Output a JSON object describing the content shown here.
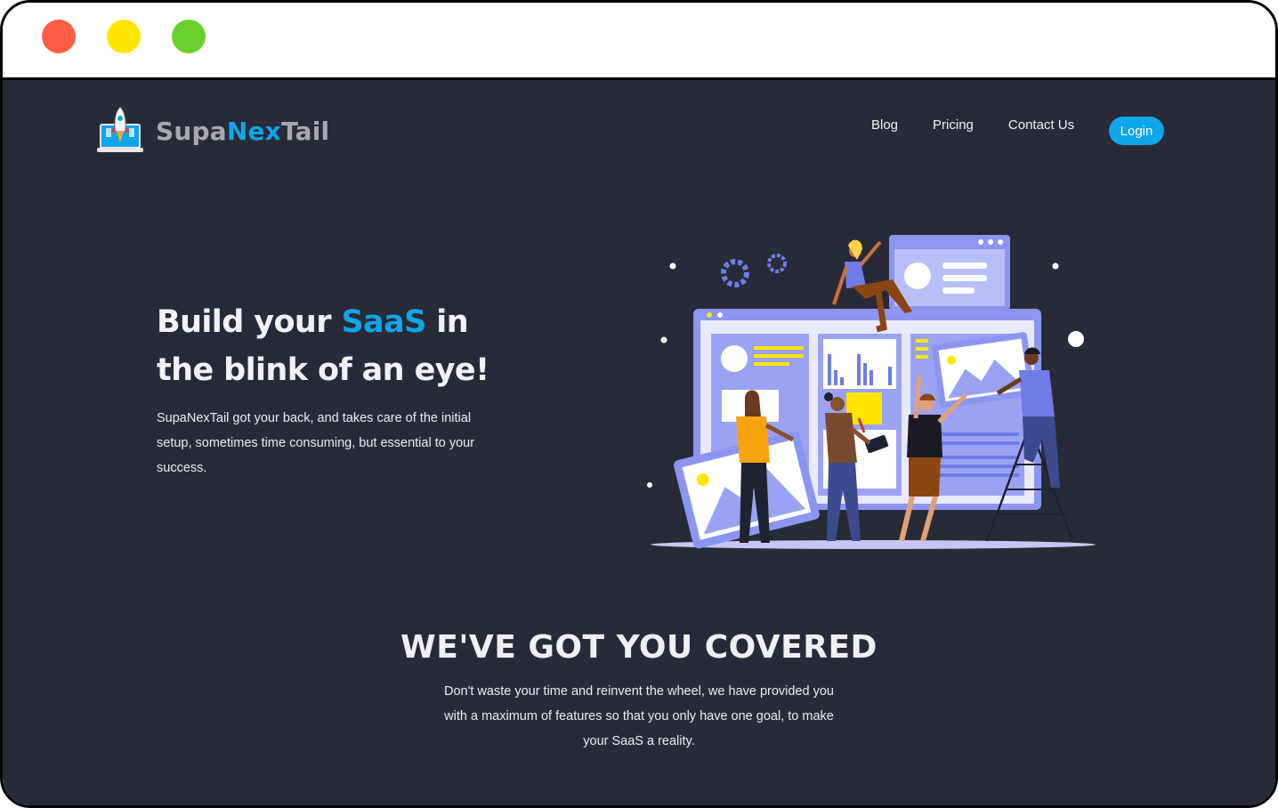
{
  "window": {
    "controls": [
      "close",
      "minimize",
      "maximize"
    ]
  },
  "brand": {
    "name_part1": "Supa",
    "name_part2": "Nex",
    "name_part3": "Tail",
    "logo_icon": "rocket-laptop-icon",
    "accent_color": "#0ea5e9"
  },
  "nav": {
    "links": [
      "Blog",
      "Pricing",
      "Contact Us"
    ],
    "login_label": "Login"
  },
  "hero": {
    "title_pre": "Build your ",
    "title_accent": "SaaS",
    "title_post": " in the blink of an eye!",
    "description": "SupaNexTail got your back, and takes care of the initial setup, sometimes time consuming, but essential to your success.",
    "illustration": "team-building-dashboard-illustration"
  },
  "features": {
    "title": "WE'VE GOT YOU COVERED",
    "description": "Don't waste your time and reinvent the wheel, we have provided you with a maximum of features so that you only have one goal, to make your SaaS a reality."
  },
  "colors": {
    "background": "#282b37",
    "accent": "#0ea5e9",
    "illustration_primary": "#8c96f0",
    "illustration_yellow": "#ffe600"
  }
}
